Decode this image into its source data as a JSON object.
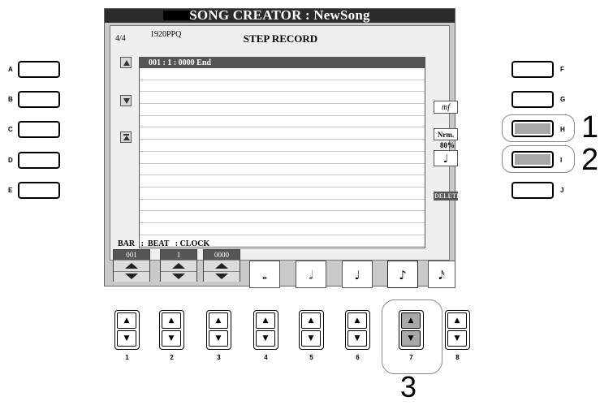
{
  "screen": {
    "title": "SONG CREATOR : NewSong",
    "panel_title": "STEP RECORD",
    "time_signature": "4/4",
    "resolution": "1920PPQ",
    "list_header": "001 : 1 : 0000     End",
    "velocity_label": "mf",
    "normal_label": "Nrm.",
    "gate_percent": "80%",
    "delete_label": "DELETE",
    "bar_beat_clock_label": "BAR   :  BEAT   : CLOCK",
    "bar_value": "001",
    "beat_value": "1",
    "clock_value": "0000",
    "note_tabs": [
      "𝅝",
      "𝅗𝅥",
      "♩",
      "♪",
      "𝅘𝅥𝅯"
    ]
  },
  "left_buttons": [
    "A",
    "B",
    "C",
    "D",
    "E"
  ],
  "right_buttons": [
    "F",
    "G",
    "H",
    "I",
    "J"
  ],
  "bottom_buttons": [
    "1",
    "2",
    "3",
    "4",
    "5",
    "6",
    "7",
    "8"
  ],
  "arrows": {
    "up": "▲",
    "down": "▼"
  },
  "callouts": {
    "h": "1",
    "i": "2",
    "seven": "3"
  }
}
